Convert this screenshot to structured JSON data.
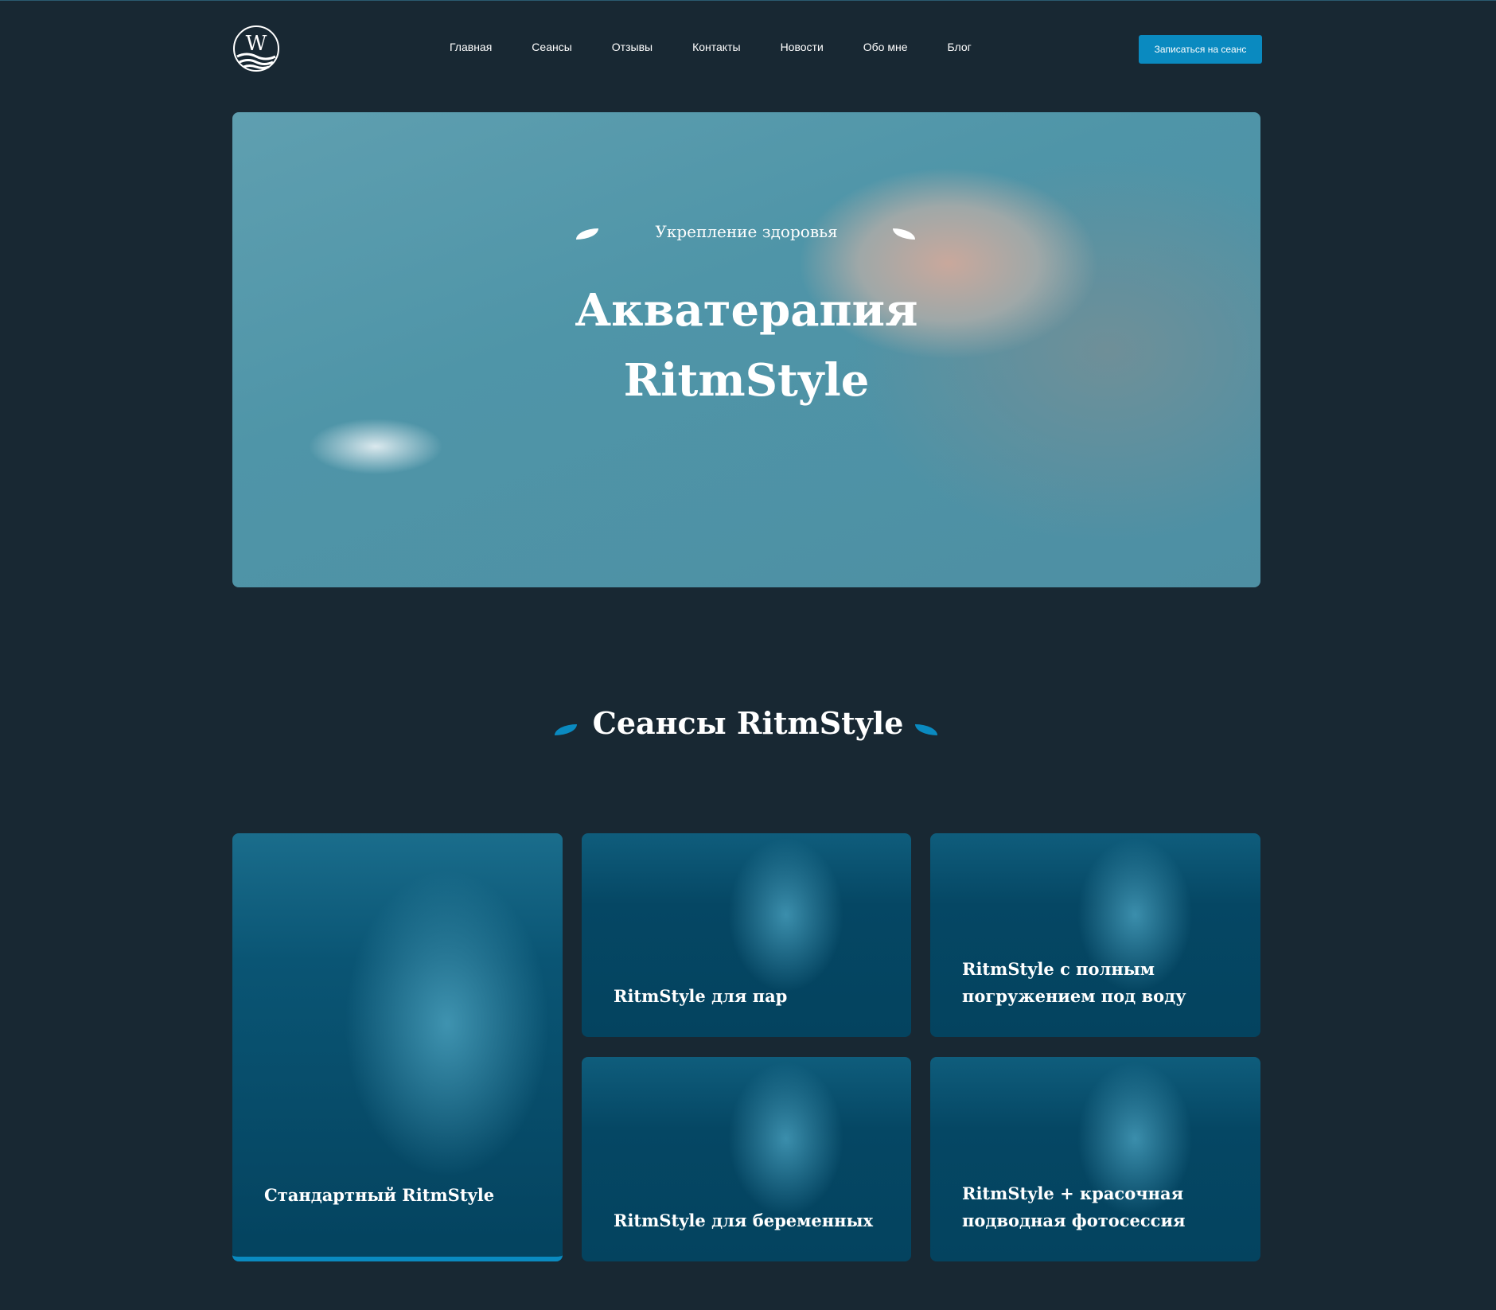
{
  "header": {
    "logo_letter": "W",
    "nav": [
      "Главная",
      "Сеансы",
      "Отзывы",
      "Контакты",
      "Новости",
      "Обо мне",
      "Блог"
    ],
    "cta": "Записаться на сеанс"
  },
  "hero": {
    "subtitle": "Укрепление здоровья",
    "title_line1": "Акватерапия",
    "title_line2": "RitmStyle"
  },
  "sessions": {
    "title": "Сеансы RitmStyle",
    "cards": [
      "Стандартный RitmStyle",
      "RitmStyle для пар",
      "RitmStyle с полным погружением под воду",
      "RitmStyle для беременных",
      "RitmStyle + красочная подводная фотосессия"
    ]
  },
  "colors": {
    "background": "#182833",
    "accent": "#0a8ac0",
    "card": "#04435f"
  }
}
